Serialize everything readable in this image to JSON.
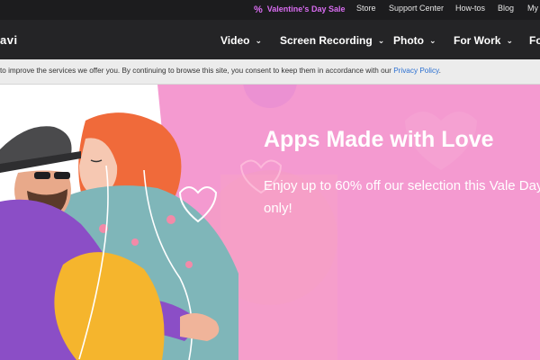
{
  "topbar": {
    "sale_label": "Valentine's Day Sale",
    "store_label": "Store",
    "support_label": "Support Center",
    "howtos_label": "How-tos",
    "blog_label": "Blog",
    "account_label": "My A"
  },
  "nav": {
    "logo_text": "avi",
    "items": [
      {
        "label": "Video"
      },
      {
        "label": "Screen Recording"
      },
      {
        "label": "Photo"
      },
      {
        "label": "For Work"
      },
      {
        "label": "Fo"
      }
    ]
  },
  "cookie": {
    "text": "to improve the services we offer you. By continuing to browse this site, you consent to keep them in accordance with our",
    "link_text": "Privacy Policy"
  },
  "hero": {
    "headline": "Apps Made with Love",
    "subtext": "Enjoy up to 60% off our selection this Vale Day only!"
  },
  "colors": {
    "hero_bg": "#f49ad0",
    "sale_accent": "#d86cf0",
    "nav_bg": "#242426",
    "topbar_bg": "#1c1c1e",
    "link": "#2a6fd1"
  }
}
